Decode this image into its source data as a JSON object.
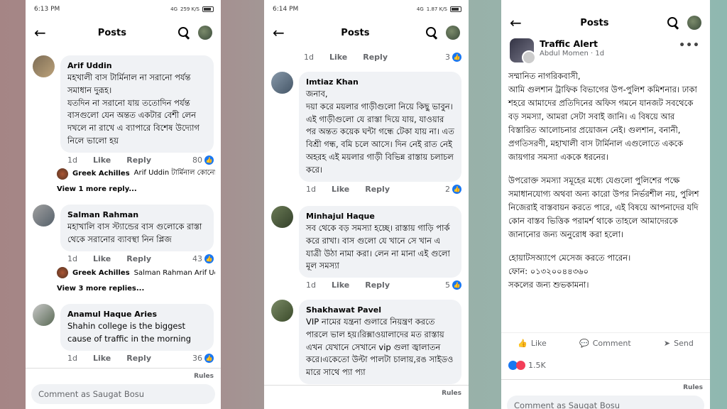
{
  "panel1": {
    "status_time": "6:13 PM",
    "status_signal": "4G",
    "status_speed": "259 K/S",
    "title": "Posts",
    "comments": [
      {
        "name": "Arif Uddin",
        "text": "মহখালী বাস টার্মিনাল না সরানো পর্যন্ত সমাধান দুরূহ।\nযতদিন না সরানো যায় ততোদিন পর্যন্ত বাসগুলো যেন অন্তত একটার বেশী লেন দখলে না রাখে এ ব্যাপারে বিশেষ উদ্যোগ নিলে ভালো হয়",
        "time": "1d",
        "like": "Like",
        "reply": "Reply",
        "count": "80"
      },
      {
        "name": "Salman Rahman",
        "text": "মহাখালি বাস স্ট্যান্ডের বাস গুলোকে রাস্তা থেকে সরানোর ব্যাবস্থা নিন প্লিজ",
        "time": "1d",
        "like": "Like",
        "reply": "Reply",
        "count": "43"
      },
      {
        "name": "Anamul Haque Aries",
        "text": "Shahin college is the biggest cause of traffic in the morning",
        "time": "1d",
        "like": "Like",
        "reply": "Reply",
        "count": "36"
      }
    ],
    "replies": [
      {
        "name": "Greek Achilles",
        "text": "Arif Uddin টার্মিনাল কোনো স...",
        "more": "View 1 more reply..."
      },
      {
        "name": "Greek Achilles",
        "text": "Salman Rahman Arif Uddi...",
        "more": "View 3 more replies..."
      }
    ],
    "rules": "Rules",
    "comment_placeholder": "Comment as Saugat Bosu"
  },
  "panel2": {
    "status_time": "6:14 PM",
    "status_signal": "4G",
    "status_speed": "1.87 K/S",
    "title": "Posts",
    "top_meta": {
      "time": "1d",
      "like": "Like",
      "reply": "Reply",
      "count": "3"
    },
    "comments": [
      {
        "name": "Imtiaz Khan",
        "text": "জনাব,\nদয়া করে ময়লার গাড়ীগুলো নিয়ে কিছু ভাবুন। এই গাড়ীগুলো যে রাস্তা দিয়ে যায়, যাওয়ার পর অন্তত কয়েক ঘন্টা গন্ধে টেকা যায় না। এত বিশ্রী গন্ধ, বমি চলে আসে। দিন নেই রাত নেই অহরহ এই ময়লার গাড়ী বিভিন্ন রাস্তায় চলাচল করে।",
        "time": "1d",
        "like": "Like",
        "reply": "Reply",
        "count": "2"
      },
      {
        "name": "Minhajul Haque",
        "text": "সব থেকে বড় সমস্যা হচ্ছে। রাস্তায় গাড়ি পার্ক করে রাখা। বাস গুলো যে খানে সে খান এ যাত্রী উঠা নামা করা। লেন না মানা এই গুলো মূল সমস্যা",
        "time": "1d",
        "like": "Like",
        "reply": "Reply",
        "count": "5"
      },
      {
        "name": "Shakhawat Pavel",
        "text": "VIP নামের যন্ত্রনা গুলারে নিয়ন্ত্রণ করতে পারলে ভাল হয়।রিক্সাওয়ালাদের মত রাস্তায় এখন যেখানে সেখানে vip গুলা জ্বালাতন করে।একেতো উল্টা পালটা চালায়,রঙ সাইডও মারে সাথে প্যা প্যা",
        "time": "",
        "like": "",
        "reply": "",
        "count": ""
      }
    ],
    "rules": "Rules"
  },
  "panel3": {
    "title": "Posts",
    "page_name": "Traffic Alert",
    "author": "Abdul Momen",
    "time": "1d",
    "paragraphs": [
      "সম্মানিত নাগরিকবাসী,\nআমি গুলশান ট্রাফিক বিভাগের উপ-পুলিশ কমিশনার। ঢাকা শহরে আমাদের প্রতিদিনের অফিস গমনে যানজট সবথেকে বড় সমস্যা, আমরা সেটা সবাই জানি। এ বিষয়ে আর বিস্তারিত আলোচনার প্রয়োজন নেই। গুলশান, বনানী, প্রগতিসরণী, মহাখালী বাস টার্মিনাল এগুলোতে এককে জায়গার সমস্যা এককে ধরনের।",
      "উপরোক্ত সমস্যা সমূহের মধ্যে যেগুলো পুলিশের পক্ষে সমাধানযোগ্য অথবা অন্য কারো উপর নির্ভরশীল নয়, পুলিশ নিজেরাই বাস্তবায়ন করতে পারে, এই বিষয়ে আপনাদের যদি কোন বাস্তব ভিত্তিক পরামর্শ থাকে তাহলে আমাদেরকে জানানোর জন্য অনুরোধ করা হলো।",
      "হোয়াটসঅ্যাপে মেসেজ করতে পারেন।\nফোন: ০১৩২০০৪৪৩৬০\nসকলের জন্য শুভকামনা।"
    ],
    "actions": {
      "like": "Like",
      "comment": "Comment",
      "send": "Send"
    },
    "reactions": "1.5K",
    "rules": "Rules",
    "comment_placeholder": "Comment as Saugat Bosu"
  }
}
